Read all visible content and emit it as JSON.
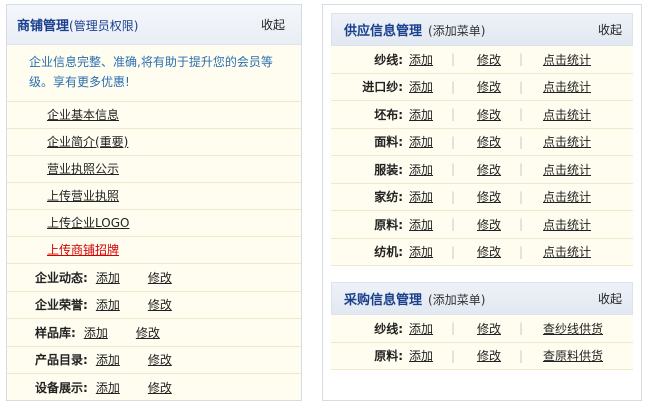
{
  "left": {
    "title": "商铺管理",
    "title_sub": "(管理员权限)",
    "collapse": "收起",
    "notice": "企业信息完整、准确,将有助于提升您的会员等级。享有更多优惠!",
    "links": [
      {
        "label": "企业基本信息"
      },
      {
        "label": "企业简介(重要)"
      },
      {
        "label": "营业执照公示"
      },
      {
        "label": "上传营业执照"
      },
      {
        "label": "上传企业LOGO"
      },
      {
        "label": "上传商铺招牌"
      }
    ],
    "managed": [
      {
        "label": "企业动态:",
        "add": "添加",
        "edit": "修改"
      },
      {
        "label": "企业荣誉:",
        "add": "添加",
        "edit": "修改"
      },
      {
        "label": "样品库:",
        "add": "添加",
        "edit": "修改"
      },
      {
        "label": "产品目录:",
        "add": "添加",
        "edit": "修改"
      },
      {
        "label": "设备展示:",
        "add": "添加",
        "edit": "修改"
      }
    ]
  },
  "supply": {
    "title": "供应信息管理",
    "sub": "(添加菜单)",
    "collapse": "收起",
    "rows": [
      {
        "label": "纱线:",
        "add": "添加",
        "edit": "修改",
        "stat": "点击统计"
      },
      {
        "label": "进口纱:",
        "add": "添加",
        "edit": "修改",
        "stat": "点击统计"
      },
      {
        "label": "坯布:",
        "add": "添加",
        "edit": "修改",
        "stat": "点击统计"
      },
      {
        "label": "面料:",
        "add": "添加",
        "edit": "修改",
        "stat": "点击统计"
      },
      {
        "label": "服装:",
        "add": "添加",
        "edit": "修改",
        "stat": "点击统计"
      },
      {
        "label": "家纺:",
        "add": "添加",
        "edit": "修改",
        "stat": "点击统计"
      },
      {
        "label": "原料:",
        "add": "添加",
        "edit": "修改",
        "stat": "点击统计"
      },
      {
        "label": "纺机:",
        "add": "添加",
        "edit": "修改",
        "stat": "点击统计"
      }
    ]
  },
  "purchase": {
    "title": "采购信息管理",
    "sub": "(添加菜单)",
    "collapse": "收起",
    "rows": [
      {
        "label": "纱线:",
        "add": "添加",
        "edit": "修改",
        "stat": "查纱线供货"
      },
      {
        "label": "原料:",
        "add": "添加",
        "edit": "修改",
        "stat": "查原料供货"
      }
    ]
  },
  "separator": "|"
}
